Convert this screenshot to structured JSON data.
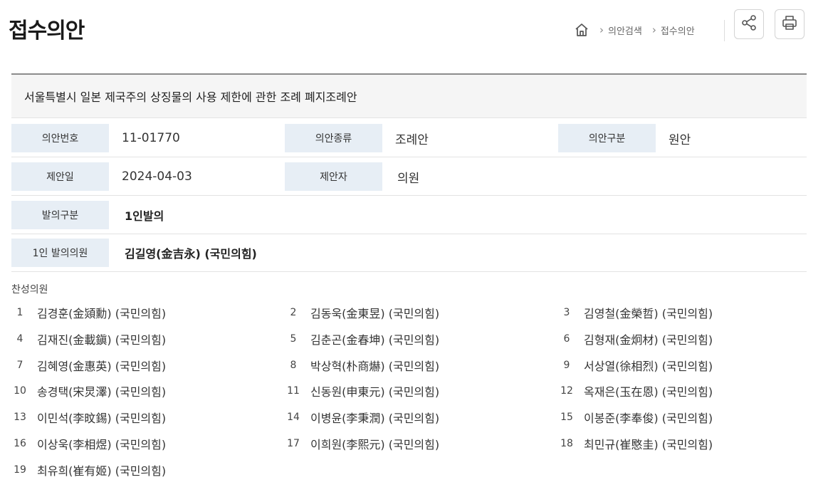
{
  "page": {
    "title": "접수의안"
  },
  "breadcrumb": {
    "items": [
      "의안검색",
      "접수의안"
    ]
  },
  "icons": {
    "home": "home-icon",
    "share": "share-icon",
    "print": "print-icon"
  },
  "bill": {
    "title": "서울특별시 일본 제국주의 상징물의 사용 제한에 관한 조례 폐지조례안",
    "fields": {
      "bill_no_label": "의안번호",
      "bill_no": "11-01770",
      "bill_type_label": "의안종류",
      "bill_type": "조례안",
      "bill_class_label": "의안구분",
      "bill_class": "원안",
      "proposed_date_label": "제안일",
      "proposed_date": "2024-04-03",
      "proposer_label": "제안자",
      "proposer": "의원",
      "proposal_type_label": "발의구분",
      "proposal_type": "1인발의",
      "sole_proposer_label": "1인 발의의원",
      "sole_proposer": "김길영(金吉永) (국민의힘)"
    }
  },
  "supporters": {
    "title": "찬성의원",
    "items": [
      {
        "no": "1",
        "name": "김경훈(金熲勳) (국민의힘)"
      },
      {
        "no": "2",
        "name": "김동욱(金東昱) (국민의힘)"
      },
      {
        "no": "3",
        "name": "김영철(金榮哲) (국민의힘)"
      },
      {
        "no": "4",
        "name": "김재진(金載鎭) (국민의힘)"
      },
      {
        "no": "5",
        "name": "김춘곤(金春坤) (국민의힘)"
      },
      {
        "no": "6",
        "name": "김형재(金炯材) (국민의힘)"
      },
      {
        "no": "7",
        "name": "김혜영(金惠英) (국민의힘)"
      },
      {
        "no": "8",
        "name": "박상혁(朴商爀) (국민의힘)"
      },
      {
        "no": "9",
        "name": "서상열(徐相烈) (국민의힘)"
      },
      {
        "no": "10",
        "name": "송경택(宋炅澤) (국민의힘)"
      },
      {
        "no": "11",
        "name": "신동원(申東元) (국민의힘)"
      },
      {
        "no": "12",
        "name": "옥재은(玉在恩) (국민의힘)"
      },
      {
        "no": "13",
        "name": "이민석(李旼錫) (국민의힘)"
      },
      {
        "no": "14",
        "name": "이병윤(李秉潤) (국민의힘)"
      },
      {
        "no": "15",
        "name": "이봉준(李奉俊) (국민의힘)"
      },
      {
        "no": "16",
        "name": "이상욱(李相煜) (국민의힘)"
      },
      {
        "no": "17",
        "name": "이희원(李熙元) (국민의힘)"
      },
      {
        "no": "18",
        "name": "최민규(崔愍圭) (국민의힘)"
      },
      {
        "no": "19",
        "name": "최유희(崔有姬) (국민의힘)"
      }
    ]
  }
}
